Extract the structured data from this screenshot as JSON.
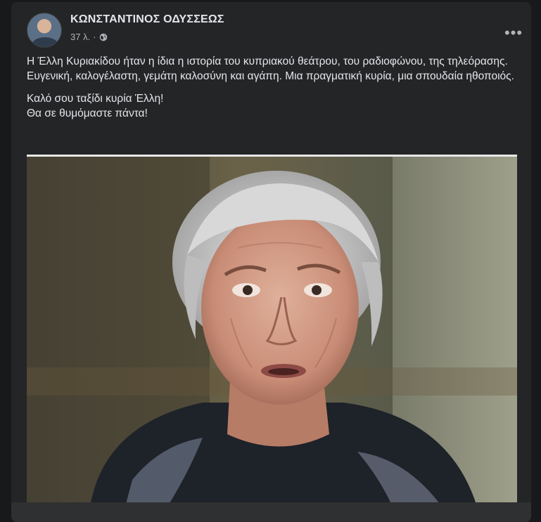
{
  "post": {
    "author": "ΚΩΝΣΤΑΝΤΙΝΟΣ ΟΔΥΣΣΕΩΣ",
    "time": "37 λ.",
    "separator": "·",
    "privacy_icon": "globe-icon",
    "more_icon": "more-options-icon",
    "more_label": "•••",
    "paragraph_1": "Η Έλλη Κυριακίδου ήταν η ίδια η ιστορία του κυπριακού θεάτρου, του ραδιοφώνου, της τηλεόρασης. Ευγενική, καλογέλαστη, γεμάτη καλοσύνη και αγάπη. Μια πραγματική κυρία, μια σπουδαία ηθοποιός.",
    "paragraph_2_line_1": "Καλό σου ταξίδι κυρία Έλλη!",
    "paragraph_2_line_2": "Θα σε θυμόμαστε πάντα!"
  },
  "colors": {
    "page_background": "#18191a",
    "card_background": "#242526",
    "primary_text": "#e4e6eb",
    "secondary_text": "#b0b3b8"
  }
}
